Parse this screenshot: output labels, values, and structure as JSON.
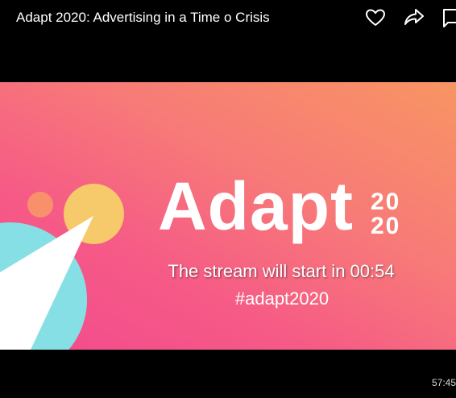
{
  "header": {
    "title": "Adapt 2020: Advertising in a Time o Crisis",
    "icons": [
      "heart-icon",
      "share-arrow-icon",
      "comment-bubble-icon"
    ]
  },
  "video": {
    "brand": "Adapt",
    "year_top": "20",
    "year_bottom": "20",
    "countdown_text": "The stream will start in 00:54",
    "hashtag": "#adapt2020"
  },
  "footer": {
    "timestamp": "57:45"
  },
  "colors": {
    "background": "#000000",
    "gradient_start": "#f89563",
    "gradient_end": "#f24a8e",
    "circle_yellow": "#f6c96a",
    "circle_teal": "#86dfe4",
    "circle_small": "#f8906c"
  }
}
